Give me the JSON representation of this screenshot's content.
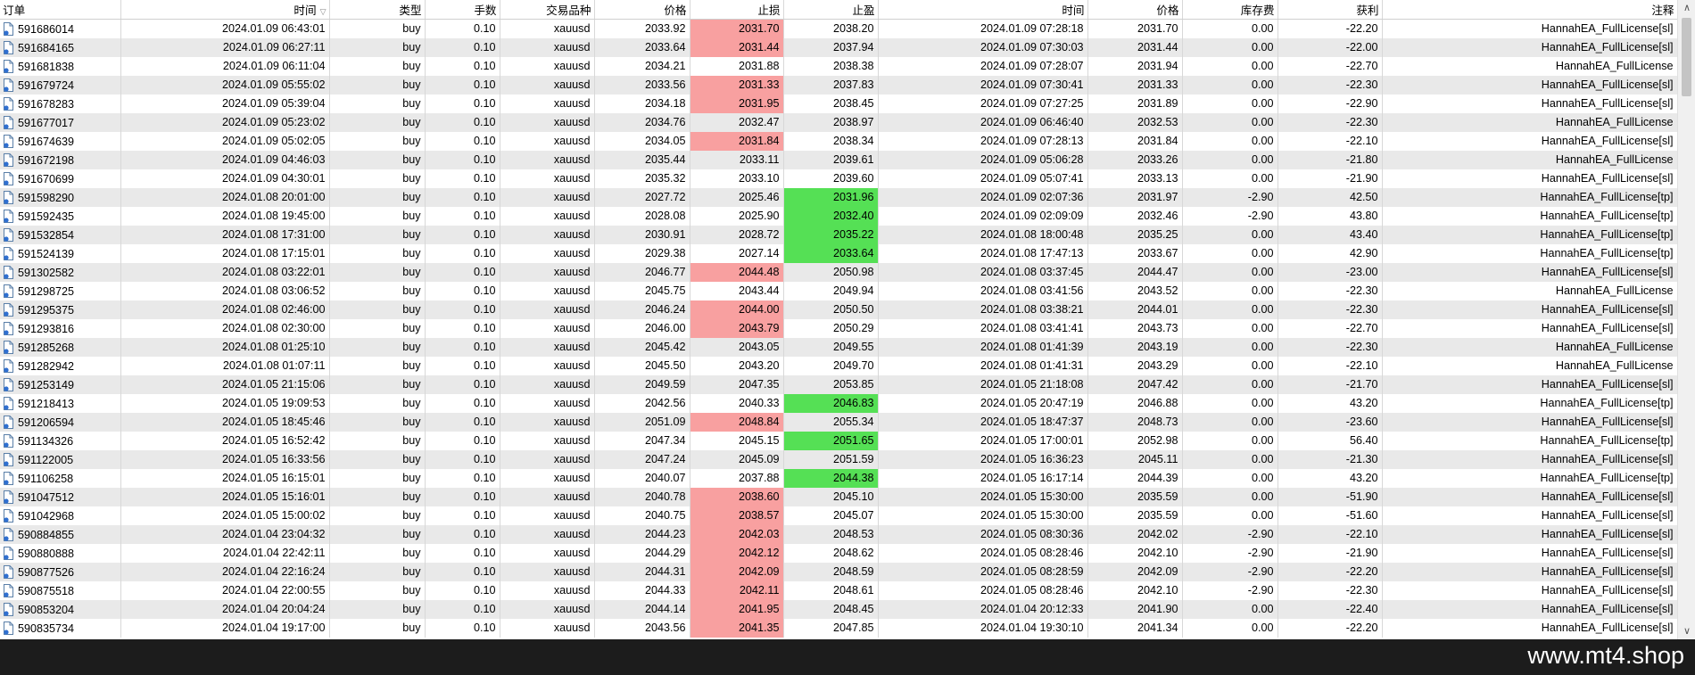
{
  "columns": [
    "订单",
    "时间",
    "类型",
    "手数",
    "交易品种",
    "价格",
    "止损",
    "止盈",
    "时间",
    "价格",
    "库存费",
    "获利",
    "注释"
  ],
  "colors": {
    "sl_hit": "#f8a0a0",
    "tp_hit": "#55e055",
    "row_alt": "#e9e9e9"
  },
  "watermark": "www.mt4.shop",
  "rows": [
    {
      "order": "591686014",
      "open_time": "2024.01.09 06:43:01",
      "type": "buy",
      "lots": "0.10",
      "symbol": "xauusd",
      "open_price": "2033.92",
      "sl": "2031.70",
      "tp": "2038.20",
      "close_time": "2024.01.09 07:28:18",
      "close_price": "2031.70",
      "swap": "0.00",
      "profit": "-22.20",
      "comment": "HannahEA_FullLicense[sl]",
      "hit": "sl"
    },
    {
      "order": "591684165",
      "open_time": "2024.01.09 06:27:11",
      "type": "buy",
      "lots": "0.10",
      "symbol": "xauusd",
      "open_price": "2033.64",
      "sl": "2031.44",
      "tp": "2037.94",
      "close_time": "2024.01.09 07:30:03",
      "close_price": "2031.44",
      "swap": "0.00",
      "profit": "-22.00",
      "comment": "HannahEA_FullLicense[sl]",
      "hit": "sl"
    },
    {
      "order": "591681838",
      "open_time": "2024.01.09 06:11:04",
      "type": "buy",
      "lots": "0.10",
      "symbol": "xauusd",
      "open_price": "2034.21",
      "sl": "2031.88",
      "tp": "2038.38",
      "close_time": "2024.01.09 07:28:07",
      "close_price": "2031.94",
      "swap": "0.00",
      "profit": "-22.70",
      "comment": "HannahEA_FullLicense",
      "hit": ""
    },
    {
      "order": "591679724",
      "open_time": "2024.01.09 05:55:02",
      "type": "buy",
      "lots": "0.10",
      "symbol": "xauusd",
      "open_price": "2033.56",
      "sl": "2031.33",
      "tp": "2037.83",
      "close_time": "2024.01.09 07:30:41",
      "close_price": "2031.33",
      "swap": "0.00",
      "profit": "-22.30",
      "comment": "HannahEA_FullLicense[sl]",
      "hit": "sl"
    },
    {
      "order": "591678283",
      "open_time": "2024.01.09 05:39:04",
      "type": "buy",
      "lots": "0.10",
      "symbol": "xauusd",
      "open_price": "2034.18",
      "sl": "2031.95",
      "tp": "2038.45",
      "close_time": "2024.01.09 07:27:25",
      "close_price": "2031.89",
      "swap": "0.00",
      "profit": "-22.90",
      "comment": "HannahEA_FullLicense[sl]",
      "hit": "sl"
    },
    {
      "order": "591677017",
      "open_time": "2024.01.09 05:23:02",
      "type": "buy",
      "lots": "0.10",
      "symbol": "xauusd",
      "open_price": "2034.76",
      "sl": "2032.47",
      "tp": "2038.97",
      "close_time": "2024.01.09 06:46:40",
      "close_price": "2032.53",
      "swap": "0.00",
      "profit": "-22.30",
      "comment": "HannahEA_FullLicense",
      "hit": ""
    },
    {
      "order": "591674639",
      "open_time": "2024.01.09 05:02:05",
      "type": "buy",
      "lots": "0.10",
      "symbol": "xauusd",
      "open_price": "2034.05",
      "sl": "2031.84",
      "tp": "2038.34",
      "close_time": "2024.01.09 07:28:13",
      "close_price": "2031.84",
      "swap": "0.00",
      "profit": "-22.10",
      "comment": "HannahEA_FullLicense[sl]",
      "hit": "sl"
    },
    {
      "order": "591672198",
      "open_time": "2024.01.09 04:46:03",
      "type": "buy",
      "lots": "0.10",
      "symbol": "xauusd",
      "open_price": "2035.44",
      "sl": "2033.11",
      "tp": "2039.61",
      "close_time": "2024.01.09 05:06:28",
      "close_price": "2033.26",
      "swap": "0.00",
      "profit": "-21.80",
      "comment": "HannahEA_FullLicense",
      "hit": ""
    },
    {
      "order": "591670699",
      "open_time": "2024.01.09 04:30:01",
      "type": "buy",
      "lots": "0.10",
      "symbol": "xauusd",
      "open_price": "2035.32",
      "sl": "2033.10",
      "tp": "2039.60",
      "close_time": "2024.01.09 05:07:41",
      "close_price": "2033.13",
      "swap": "0.00",
      "profit": "-21.90",
      "comment": "HannahEA_FullLicense[sl]",
      "hit": ""
    },
    {
      "order": "591598290",
      "open_time": "2024.01.08 20:01:00",
      "type": "buy",
      "lots": "0.10",
      "symbol": "xauusd",
      "open_price": "2027.72",
      "sl": "2025.46",
      "tp": "2031.96",
      "close_time": "2024.01.09 02:07:36",
      "close_price": "2031.97",
      "swap": "-2.90",
      "profit": "42.50",
      "comment": "HannahEA_FullLicense[tp]",
      "hit": "tp"
    },
    {
      "order": "591592435",
      "open_time": "2024.01.08 19:45:00",
      "type": "buy",
      "lots": "0.10",
      "symbol": "xauusd",
      "open_price": "2028.08",
      "sl": "2025.90",
      "tp": "2032.40",
      "close_time": "2024.01.09 02:09:09",
      "close_price": "2032.46",
      "swap": "-2.90",
      "profit": "43.80",
      "comment": "HannahEA_FullLicense[tp]",
      "hit": "tp"
    },
    {
      "order": "591532854",
      "open_time": "2024.01.08 17:31:00",
      "type": "buy",
      "lots": "0.10",
      "symbol": "xauusd",
      "open_price": "2030.91",
      "sl": "2028.72",
      "tp": "2035.22",
      "close_time": "2024.01.08 18:00:48",
      "close_price": "2035.25",
      "swap": "0.00",
      "profit": "43.40",
      "comment": "HannahEA_FullLicense[tp]",
      "hit": "tp"
    },
    {
      "order": "591524139",
      "open_time": "2024.01.08 17:15:01",
      "type": "buy",
      "lots": "0.10",
      "symbol": "xauusd",
      "open_price": "2029.38",
      "sl": "2027.14",
      "tp": "2033.64",
      "close_time": "2024.01.08 17:47:13",
      "close_price": "2033.67",
      "swap": "0.00",
      "profit": "42.90",
      "comment": "HannahEA_FullLicense[tp]",
      "hit": "tp"
    },
    {
      "order": "591302582",
      "open_time": "2024.01.08 03:22:01",
      "type": "buy",
      "lots": "0.10",
      "symbol": "xauusd",
      "open_price": "2046.77",
      "sl": "2044.48",
      "tp": "2050.98",
      "close_time": "2024.01.08 03:37:45",
      "close_price": "2044.47",
      "swap": "0.00",
      "profit": "-23.00",
      "comment": "HannahEA_FullLicense[sl]",
      "hit": "sl"
    },
    {
      "order": "591298725",
      "open_time": "2024.01.08 03:06:52",
      "type": "buy",
      "lots": "0.10",
      "symbol": "xauusd",
      "open_price": "2045.75",
      "sl": "2043.44",
      "tp": "2049.94",
      "close_time": "2024.01.08 03:41:56",
      "close_price": "2043.52",
      "swap": "0.00",
      "profit": "-22.30",
      "comment": "HannahEA_FullLicense",
      "hit": ""
    },
    {
      "order": "591295375",
      "open_time": "2024.01.08 02:46:00",
      "type": "buy",
      "lots": "0.10",
      "symbol": "xauusd",
      "open_price": "2046.24",
      "sl": "2044.00",
      "tp": "2050.50",
      "close_time": "2024.01.08 03:38:21",
      "close_price": "2044.01",
      "swap": "0.00",
      "profit": "-22.30",
      "comment": "HannahEA_FullLicense[sl]",
      "hit": "sl"
    },
    {
      "order": "591293816",
      "open_time": "2024.01.08 02:30:00",
      "type": "buy",
      "lots": "0.10",
      "symbol": "xauusd",
      "open_price": "2046.00",
      "sl": "2043.79",
      "tp": "2050.29",
      "close_time": "2024.01.08 03:41:41",
      "close_price": "2043.73",
      "swap": "0.00",
      "profit": "-22.70",
      "comment": "HannahEA_FullLicense[sl]",
      "hit": "sl"
    },
    {
      "order": "591285268",
      "open_time": "2024.01.08 01:25:10",
      "type": "buy",
      "lots": "0.10",
      "symbol": "xauusd",
      "open_price": "2045.42",
      "sl": "2043.05",
      "tp": "2049.55",
      "close_time": "2024.01.08 01:41:39",
      "close_price": "2043.19",
      "swap": "0.00",
      "profit": "-22.30",
      "comment": "HannahEA_FullLicense",
      "hit": ""
    },
    {
      "order": "591282942",
      "open_time": "2024.01.08 01:07:11",
      "type": "buy",
      "lots": "0.10",
      "symbol": "xauusd",
      "open_price": "2045.50",
      "sl": "2043.20",
      "tp": "2049.70",
      "close_time": "2024.01.08 01:41:31",
      "close_price": "2043.29",
      "swap": "0.00",
      "profit": "-22.10",
      "comment": "HannahEA_FullLicense",
      "hit": ""
    },
    {
      "order": "591253149",
      "open_time": "2024.01.05 21:15:06",
      "type": "buy",
      "lots": "0.10",
      "symbol": "xauusd",
      "open_price": "2049.59",
      "sl": "2047.35",
      "tp": "2053.85",
      "close_time": "2024.01.05 21:18:08",
      "close_price": "2047.42",
      "swap": "0.00",
      "profit": "-21.70",
      "comment": "HannahEA_FullLicense[sl]",
      "hit": ""
    },
    {
      "order": "591218413",
      "open_time": "2024.01.05 19:09:53",
      "type": "buy",
      "lots": "0.10",
      "symbol": "xauusd",
      "open_price": "2042.56",
      "sl": "2040.33",
      "tp": "2046.83",
      "close_time": "2024.01.05 20:47:19",
      "close_price": "2046.88",
      "swap": "0.00",
      "profit": "43.20",
      "comment": "HannahEA_FullLicense[tp]",
      "hit": "tp"
    },
    {
      "order": "591206594",
      "open_time": "2024.01.05 18:45:46",
      "type": "buy",
      "lots": "0.10",
      "symbol": "xauusd",
      "open_price": "2051.09",
      "sl": "2048.84",
      "tp": "2055.34",
      "close_time": "2024.01.05 18:47:37",
      "close_price": "2048.73",
      "swap": "0.00",
      "profit": "-23.60",
      "comment": "HannahEA_FullLicense[sl]",
      "hit": "sl"
    },
    {
      "order": "591134326",
      "open_time": "2024.01.05 16:52:42",
      "type": "buy",
      "lots": "0.10",
      "symbol": "xauusd",
      "open_price": "2047.34",
      "sl": "2045.15",
      "tp": "2051.65",
      "close_time": "2024.01.05 17:00:01",
      "close_price": "2052.98",
      "swap": "0.00",
      "profit": "56.40",
      "comment": "HannahEA_FullLicense[tp]",
      "hit": "tp"
    },
    {
      "order": "591122005",
      "open_time": "2024.01.05 16:33:56",
      "type": "buy",
      "lots": "0.10",
      "symbol": "xauusd",
      "open_price": "2047.24",
      "sl": "2045.09",
      "tp": "2051.59",
      "close_time": "2024.01.05 16:36:23",
      "close_price": "2045.11",
      "swap": "0.00",
      "profit": "-21.30",
      "comment": "HannahEA_FullLicense[sl]",
      "hit": ""
    },
    {
      "order": "591106258",
      "open_time": "2024.01.05 16:15:01",
      "type": "buy",
      "lots": "0.10",
      "symbol": "xauusd",
      "open_price": "2040.07",
      "sl": "2037.88",
      "tp": "2044.38",
      "close_time": "2024.01.05 16:17:14",
      "close_price": "2044.39",
      "swap": "0.00",
      "profit": "43.20",
      "comment": "HannahEA_FullLicense[tp]",
      "hit": "tp"
    },
    {
      "order": "591047512",
      "open_time": "2024.01.05 15:16:01",
      "type": "buy",
      "lots": "0.10",
      "symbol": "xauusd",
      "open_price": "2040.78",
      "sl": "2038.60",
      "tp": "2045.10",
      "close_time": "2024.01.05 15:30:00",
      "close_price": "2035.59",
      "swap": "0.00",
      "profit": "-51.90",
      "comment": "HannahEA_FullLicense[sl]",
      "hit": "sl"
    },
    {
      "order": "591042968",
      "open_time": "2024.01.05 15:00:02",
      "type": "buy",
      "lots": "0.10",
      "symbol": "xauusd",
      "open_price": "2040.75",
      "sl": "2038.57",
      "tp": "2045.07",
      "close_time": "2024.01.05 15:30:00",
      "close_price": "2035.59",
      "swap": "0.00",
      "profit": "-51.60",
      "comment": "HannahEA_FullLicense[sl]",
      "hit": "sl"
    },
    {
      "order": "590884855",
      "open_time": "2024.01.04 23:04:32",
      "type": "buy",
      "lots": "0.10",
      "symbol": "xauusd",
      "open_price": "2044.23",
      "sl": "2042.03",
      "tp": "2048.53",
      "close_time": "2024.01.05 08:30:36",
      "close_price": "2042.02",
      "swap": "-2.90",
      "profit": "-22.10",
      "comment": "HannahEA_FullLicense[sl]",
      "hit": "sl"
    },
    {
      "order": "590880888",
      "open_time": "2024.01.04 22:42:11",
      "type": "buy",
      "lots": "0.10",
      "symbol": "xauusd",
      "open_price": "2044.29",
      "sl": "2042.12",
      "tp": "2048.62",
      "close_time": "2024.01.05 08:28:46",
      "close_price": "2042.10",
      "swap": "-2.90",
      "profit": "-21.90",
      "comment": "HannahEA_FullLicense[sl]",
      "hit": "sl"
    },
    {
      "order": "590877526",
      "open_time": "2024.01.04 22:16:24",
      "type": "buy",
      "lots": "0.10",
      "symbol": "xauusd",
      "open_price": "2044.31",
      "sl": "2042.09",
      "tp": "2048.59",
      "close_time": "2024.01.05 08:28:59",
      "close_price": "2042.09",
      "swap": "-2.90",
      "profit": "-22.20",
      "comment": "HannahEA_FullLicense[sl]",
      "hit": "sl"
    },
    {
      "order": "590875518",
      "open_time": "2024.01.04 22:00:55",
      "type": "buy",
      "lots": "0.10",
      "symbol": "xauusd",
      "open_price": "2044.33",
      "sl": "2042.11",
      "tp": "2048.61",
      "close_time": "2024.01.05 08:28:46",
      "close_price": "2042.10",
      "swap": "-2.90",
      "profit": "-22.30",
      "comment": "HannahEA_FullLicense[sl]",
      "hit": "sl"
    },
    {
      "order": "590853204",
      "open_time": "2024.01.04 20:04:24",
      "type": "buy",
      "lots": "0.10",
      "symbol": "xauusd",
      "open_price": "2044.14",
      "sl": "2041.95",
      "tp": "2048.45",
      "close_time": "2024.01.04 20:12:33",
      "close_price": "2041.90",
      "swap": "0.00",
      "profit": "-22.40",
      "comment": "HannahEA_FullLicense[sl]",
      "hit": "sl"
    },
    {
      "order": "590835734",
      "open_time": "2024.01.04 19:17:00",
      "type": "buy",
      "lots": "0.10",
      "symbol": "xauusd",
      "open_price": "2043.56",
      "sl": "2041.35",
      "tp": "2047.85",
      "close_time": "2024.01.04 19:30:10",
      "close_price": "2041.34",
      "swap": "0.00",
      "profit": "-22.20",
      "comment": "HannahEA_FullLicense[sl]",
      "hit": "sl"
    }
  ]
}
